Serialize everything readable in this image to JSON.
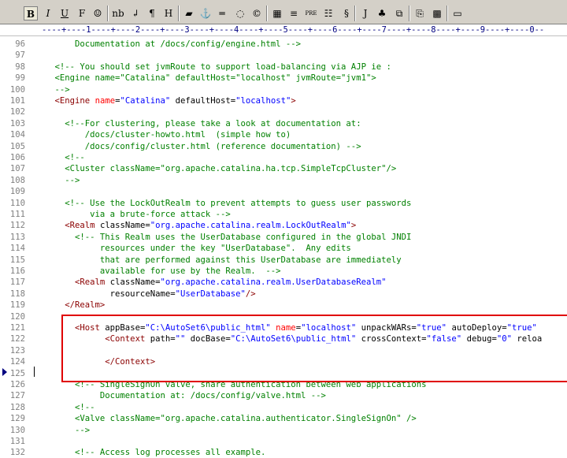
{
  "toolbar": {
    "buttons": [
      {
        "name": "bold-button",
        "label": "B"
      },
      {
        "name": "italic-button",
        "label": "I"
      },
      {
        "name": "underline-button",
        "label": "U"
      },
      {
        "name": "font-button",
        "label": "F"
      },
      {
        "name": "special-char-button",
        "label": "☺"
      },
      {
        "name": "nbsp-button",
        "label": "nb"
      },
      {
        "name": "line-break-button",
        "label": "↲"
      },
      {
        "name": "paragraph-button",
        "label": "¶"
      },
      {
        "name": "heading-button",
        "label": "H"
      },
      {
        "name": "color-picker-button",
        "label": "▰"
      },
      {
        "name": "anchor-button",
        "label": "⚓"
      },
      {
        "name": "horizontal-rule-button",
        "label": "═"
      },
      {
        "name": "image-button",
        "label": "◌"
      },
      {
        "name": "comment-button",
        "label": "©"
      },
      {
        "name": "table-button",
        "label": "▦"
      },
      {
        "name": "center-button",
        "label": "≡"
      },
      {
        "name": "pre-button",
        "label": "PRE"
      },
      {
        "name": "list-button",
        "label": "☷"
      },
      {
        "name": "format-button",
        "label": "§"
      },
      {
        "name": "javascript-button",
        "label": "J"
      },
      {
        "name": "plugin-button",
        "label": "♣"
      },
      {
        "name": "copy-button",
        "label": "⧉"
      },
      {
        "name": "paste-button",
        "label": "⎘"
      },
      {
        "name": "colors-button",
        "label": "▩"
      },
      {
        "name": "window-button",
        "label": "▭"
      }
    ]
  },
  "ruler": {
    "text": "----+----1----+----2----+----3----+----4----+----5----+----6----+----7----+----8----+----9----+----0--"
  },
  "lines": [
    {
      "n": "96",
      "segs": [
        [
          "c",
          "        Documentation at /docs/config/engine.html -->"
        ]
      ]
    },
    {
      "n": "97",
      "segs": [
        [
          "p",
          ""
        ]
      ]
    },
    {
      "n": "98",
      "segs": [
        [
          "c",
          "    <!-- You should set jvmRoute to support load-balancing via AJP ie :"
        ]
      ]
    },
    {
      "n": "99",
      "segs": [
        [
          "c",
          "    <Engine name=\"Catalina\" defaultHost=\"localhost\" jvmRoute=\"jvm1\">"
        ]
      ]
    },
    {
      "n": "100",
      "segs": [
        [
          "c",
          "    -->"
        ]
      ]
    },
    {
      "n": "101",
      "segs": [
        [
          "p",
          "    "
        ],
        [
          "t",
          "<Engine"
        ],
        [
          "p",
          " "
        ],
        [
          "a",
          "name"
        ],
        [
          "p",
          "="
        ],
        [
          "v",
          "\"Catalina\""
        ],
        [
          "p",
          " defaultHost="
        ],
        [
          "v",
          "\"localhost\""
        ],
        [
          "t",
          ">"
        ]
      ]
    },
    {
      "n": "102",
      "segs": [
        [
          "p",
          ""
        ]
      ]
    },
    {
      "n": "103",
      "segs": [
        [
          "c",
          "      <!--For clustering, please take a look at documentation at:"
        ]
      ]
    },
    {
      "n": "104",
      "segs": [
        [
          "c",
          "          /docs/cluster-howto.html  (simple how to)"
        ]
      ]
    },
    {
      "n": "105",
      "segs": [
        [
          "c",
          "          /docs/config/cluster.html (reference documentation) -->"
        ]
      ]
    },
    {
      "n": "106",
      "segs": [
        [
          "c",
          "      <!--"
        ]
      ]
    },
    {
      "n": "107",
      "segs": [
        [
          "c",
          "      <Cluster className=\"org.apache.catalina.ha.tcp.SimpleTcpCluster\"/>"
        ]
      ]
    },
    {
      "n": "108",
      "segs": [
        [
          "c",
          "      -->"
        ]
      ]
    },
    {
      "n": "109",
      "segs": [
        [
          "p",
          ""
        ]
      ]
    },
    {
      "n": "110",
      "segs": [
        [
          "c",
          "      <!-- Use the LockOutRealm to prevent attempts to guess user passwords"
        ]
      ]
    },
    {
      "n": "111",
      "segs": [
        [
          "c",
          "           via a brute-force attack -->"
        ]
      ]
    },
    {
      "n": "112",
      "segs": [
        [
          "p",
          "      "
        ],
        [
          "t",
          "<Realm"
        ],
        [
          "p",
          " className="
        ],
        [
          "v",
          "\"org.apache.catalina.realm.LockOutRealm\""
        ],
        [
          "t",
          ">"
        ]
      ]
    },
    {
      "n": "113",
      "segs": [
        [
          "c",
          "        <!-- This Realm uses the UserDatabase configured in the global JNDI"
        ]
      ]
    },
    {
      "n": "114",
      "segs": [
        [
          "c",
          "             resources under the key \"UserDatabase\".  Any edits"
        ]
      ]
    },
    {
      "n": "115",
      "segs": [
        [
          "c",
          "             that are performed against this UserDatabase are immediately"
        ]
      ]
    },
    {
      "n": "116",
      "segs": [
        [
          "c",
          "             available for use by the Realm.  -->"
        ]
      ]
    },
    {
      "n": "117",
      "segs": [
        [
          "p",
          "        "
        ],
        [
          "t",
          "<Realm"
        ],
        [
          "p",
          " className="
        ],
        [
          "v",
          "\"org.apache.catalina.realm.UserDatabaseRealm\""
        ]
      ]
    },
    {
      "n": "118",
      "segs": [
        [
          "p",
          "               resourceName="
        ],
        [
          "v",
          "\"UserDatabase\""
        ],
        [
          "t",
          "/>"
        ]
      ]
    },
    {
      "n": "119",
      "segs": [
        [
          "p",
          "      "
        ],
        [
          "t",
          "</Realm>"
        ]
      ]
    },
    {
      "n": "120",
      "segs": [
        [
          "p",
          ""
        ]
      ]
    },
    {
      "n": "121",
      "segs": [
        [
          "p",
          "        "
        ],
        [
          "t",
          "<Host"
        ],
        [
          "p",
          " appBase="
        ],
        [
          "v",
          "\"C:\\AutoSet6\\public_html\""
        ],
        [
          "p",
          " "
        ],
        [
          "a",
          "name"
        ],
        [
          "p",
          "="
        ],
        [
          "v",
          "\"localhost\""
        ],
        [
          "p",
          " unpackWARs="
        ],
        [
          "v",
          "\"true\""
        ],
        [
          "p",
          " autoDeploy="
        ],
        [
          "v",
          "\"true\""
        ]
      ]
    },
    {
      "n": "122",
      "segs": [
        [
          "p",
          "              "
        ],
        [
          "t",
          "<Context"
        ],
        [
          "p",
          " path="
        ],
        [
          "v",
          "\"\""
        ],
        [
          "p",
          " docBase="
        ],
        [
          "v",
          "\"C:\\AutoSet6\\public_html\""
        ],
        [
          "p",
          " crossContext="
        ],
        [
          "v",
          "\"false\""
        ],
        [
          "p",
          " debug="
        ],
        [
          "v",
          "\"0\""
        ],
        [
          "p",
          " reloa"
        ]
      ]
    },
    {
      "n": "123",
      "segs": [
        [
          "p",
          ""
        ]
      ]
    },
    {
      "n": "124",
      "segs": [
        [
          "p",
          "              "
        ],
        [
          "t",
          "</Context>"
        ]
      ]
    },
    {
      "n": "125",
      "segs": [
        [
          "p",
          ""
        ]
      ]
    },
    {
      "n": "126",
      "segs": [
        [
          "c",
          "        <!-- SingleSignOn valve, share authentication between web applications"
        ]
      ]
    },
    {
      "n": "127",
      "segs": [
        [
          "c",
          "             Documentation at: /docs/config/valve.html -->"
        ]
      ]
    },
    {
      "n": "128",
      "segs": [
        [
          "c",
          "        <!--"
        ]
      ]
    },
    {
      "n": "129",
      "segs": [
        [
          "c",
          "        <Valve className=\"org.apache.catalina.authenticator.SingleSignOn\" />"
        ]
      ]
    },
    {
      "n": "130",
      "segs": [
        [
          "c",
          "        -->"
        ]
      ]
    },
    {
      "n": "131",
      "segs": [
        [
          "p",
          ""
        ]
      ]
    },
    {
      "n": "132",
      "segs": [
        [
          "c",
          "        <!-- Access log processes all example."
        ]
      ]
    }
  ]
}
